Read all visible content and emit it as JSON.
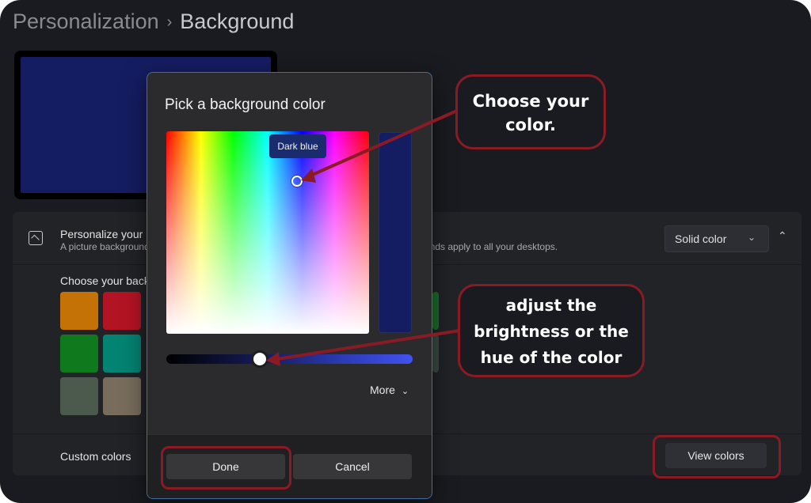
{
  "breadcrumb": {
    "parent": "Personalization",
    "separator": "›",
    "current": "Background"
  },
  "background_card": {
    "title": "Personalize your b",
    "description": "A picture background",
    "description_tail": "unds apply to all your desktops.",
    "dropdown_value": "Solid color",
    "collapse_icon": "chevron-up-icon"
  },
  "choose_color": {
    "label": "Choose your back"
  },
  "swatches": [
    "#c47206",
    "#b31424",
    "#0f7a1d",
    "#038372",
    "#4b5a4d",
    "#786d5c"
  ],
  "custom_colors": {
    "label": "Custom colors",
    "view_button": "View colors"
  },
  "dialog": {
    "title": "Pick a background color",
    "tooltip": "Dark blue",
    "selected_color": "#151d62",
    "brightness_fraction": 0.38,
    "more_label": "More",
    "done_label": "Done",
    "cancel_label": "Cancel"
  },
  "annotations": {
    "choose": {
      "line1": "Choose your",
      "line2": "color."
    },
    "adjust": {
      "line1": "adjust the",
      "line2": "brightness or the",
      "line3": "hue of the color"
    },
    "color": "#8a1a24"
  }
}
